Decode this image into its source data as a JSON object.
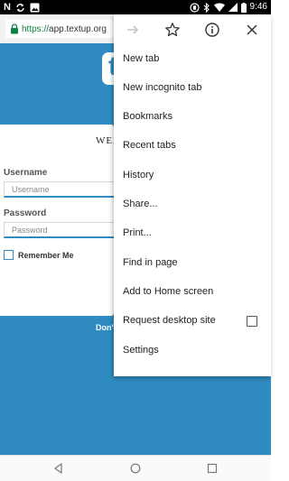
{
  "status_bar": {
    "time": "9:46",
    "notification_app": "N"
  },
  "browser": {
    "url_scheme": "https://",
    "url_host": "app.textup.org"
  },
  "page": {
    "logo_letter": "t",
    "welcome": "WEL",
    "username_label": "Username",
    "username_placeholder": "Username",
    "password_label": "Password",
    "password_placeholder": "Password",
    "remember_label": "Remember Me",
    "dont_text": "Don't",
    "accent_color": "#2f8bc0"
  },
  "menu": {
    "top_icons": [
      "forward-arrow-icon",
      "star-icon",
      "info-icon",
      "close-icon"
    ],
    "items": [
      {
        "label": "New tab"
      },
      {
        "label": "New incognito tab"
      },
      {
        "label": "Bookmarks"
      },
      {
        "label": "Recent tabs"
      },
      {
        "label": "History"
      },
      {
        "label": "Share..."
      },
      {
        "label": "Print..."
      },
      {
        "label": "Find in page"
      },
      {
        "label": "Add to Home screen"
      },
      {
        "label": "Request desktop site",
        "checked": false
      },
      {
        "label": "Settings"
      }
    ]
  }
}
